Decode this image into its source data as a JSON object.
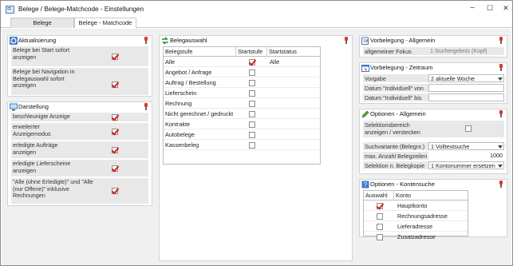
{
  "window": {
    "title": "Belege / Belege-Matchcode - Einstellungen",
    "minimize": "−",
    "maximize": "☐",
    "close": "✕"
  },
  "tabs": [
    {
      "label": "Belege"
    },
    {
      "label": "Belege - Matchcode"
    }
  ],
  "aktualisierung": {
    "title": "Aktualisierung",
    "rows": [
      {
        "label": "Belege bei Start sofort anzeigen",
        "checked": true
      },
      {
        "label": "Belege bei Navigation in Belegauswahl sofort anzeigen",
        "checked": true
      }
    ]
  },
  "darstellung": {
    "title": "Darstellung",
    "rows": [
      {
        "label": "beschleunigte Anzeige",
        "checked": true
      },
      {
        "label": "erweiterter Anzeigemodus",
        "checked": true
      },
      {
        "label": "erledigte Aufträge anzeigen",
        "checked": true
      },
      {
        "label": "erledigte Lieferscheine anzeigen",
        "checked": true
      },
      {
        "label": "\"Alle (ohne Erledigte)\" und \"Alle (nur Offene)\" inklusive Rechnungen",
        "checked": true
      }
    ]
  },
  "belegauswahl": {
    "title": "Belegauswahl",
    "columns": [
      "Belegstufe",
      "Startstufe",
      "Startstatus"
    ],
    "rows": [
      {
        "stufe": "Alle",
        "start": true,
        "status": "Alle"
      },
      {
        "stufe": "Angebot / Anfrage",
        "start": false,
        "status": ""
      },
      {
        "stufe": "Auftrag / Bestellung",
        "start": false,
        "status": ""
      },
      {
        "stufe": "Lieferschein",
        "start": false,
        "status": ""
      },
      {
        "stufe": "Rechnung",
        "start": false,
        "status": ""
      },
      {
        "stufe": "Nicht gerechnet / gedruckt",
        "start": false,
        "status": ""
      },
      {
        "stufe": "Kontrakte",
        "start": false,
        "status": ""
      },
      {
        "stufe": "Autobelege",
        "start": false,
        "status": ""
      },
      {
        "stufe": "Kassenbeleg",
        "start": false,
        "status": ""
      }
    ]
  },
  "vorbelegung_allgemein": {
    "title": "Vorbelegung - Allgemein",
    "fokus_label": "allgemeiner Fokus",
    "fokus_value": "1 Suchergebnis (Kopf)"
  },
  "vorbelegung_zeitraum": {
    "title": "Vorbelegung - Zeitraum",
    "vorgabe_label": "Vorgabe",
    "vorgabe_value": "2 aktuelle Woche",
    "von_label": "Datum \"Individuell\" von",
    "bis_label": "Datum \"Individuell\" bis"
  },
  "optionen_allgemein": {
    "title": "Optionen - Allgemein",
    "selektion_label": "Selektionsbereich anzeigen / verstecken",
    "selektion_checked": false,
    "suchvariante_label": "Suchvariante (Belegnr.)",
    "suchvariante_value": "1 Volltextsuche",
    "max_label": "max. Anzahl Belegzeilen",
    "max_value": "1000",
    "belegkopie_label": "Selektion n. Belegkopie",
    "belegkopie_value": "1 Kontonummer ersetzen"
  },
  "optionen_kontensuche": {
    "title": "Optionen - Kontensuche",
    "columns": [
      "Auswahl",
      "Konto"
    ],
    "rows": [
      {
        "checked": true,
        "konto": "Hauptkonto"
      },
      {
        "checked": false,
        "konto": "Rechnungsadresse"
      },
      {
        "checked": false,
        "konto": "Lieferadresse"
      },
      {
        "checked": false,
        "konto": "Zusatzadresse"
      }
    ]
  }
}
